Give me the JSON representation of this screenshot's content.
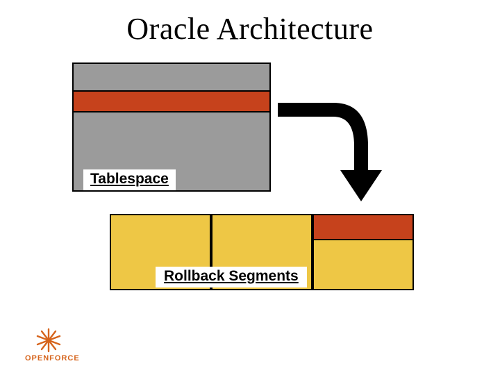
{
  "title": "Oracle Architecture",
  "labels": {
    "tablespace": "Tablespace",
    "rollback": "Rollback Segments"
  },
  "logo": {
    "text": "OPENFORCE"
  },
  "colors": {
    "gray": "#9b9b9b",
    "red": "#c6421c",
    "yellow": "#eec745",
    "logo_orange": "#d6641c"
  }
}
